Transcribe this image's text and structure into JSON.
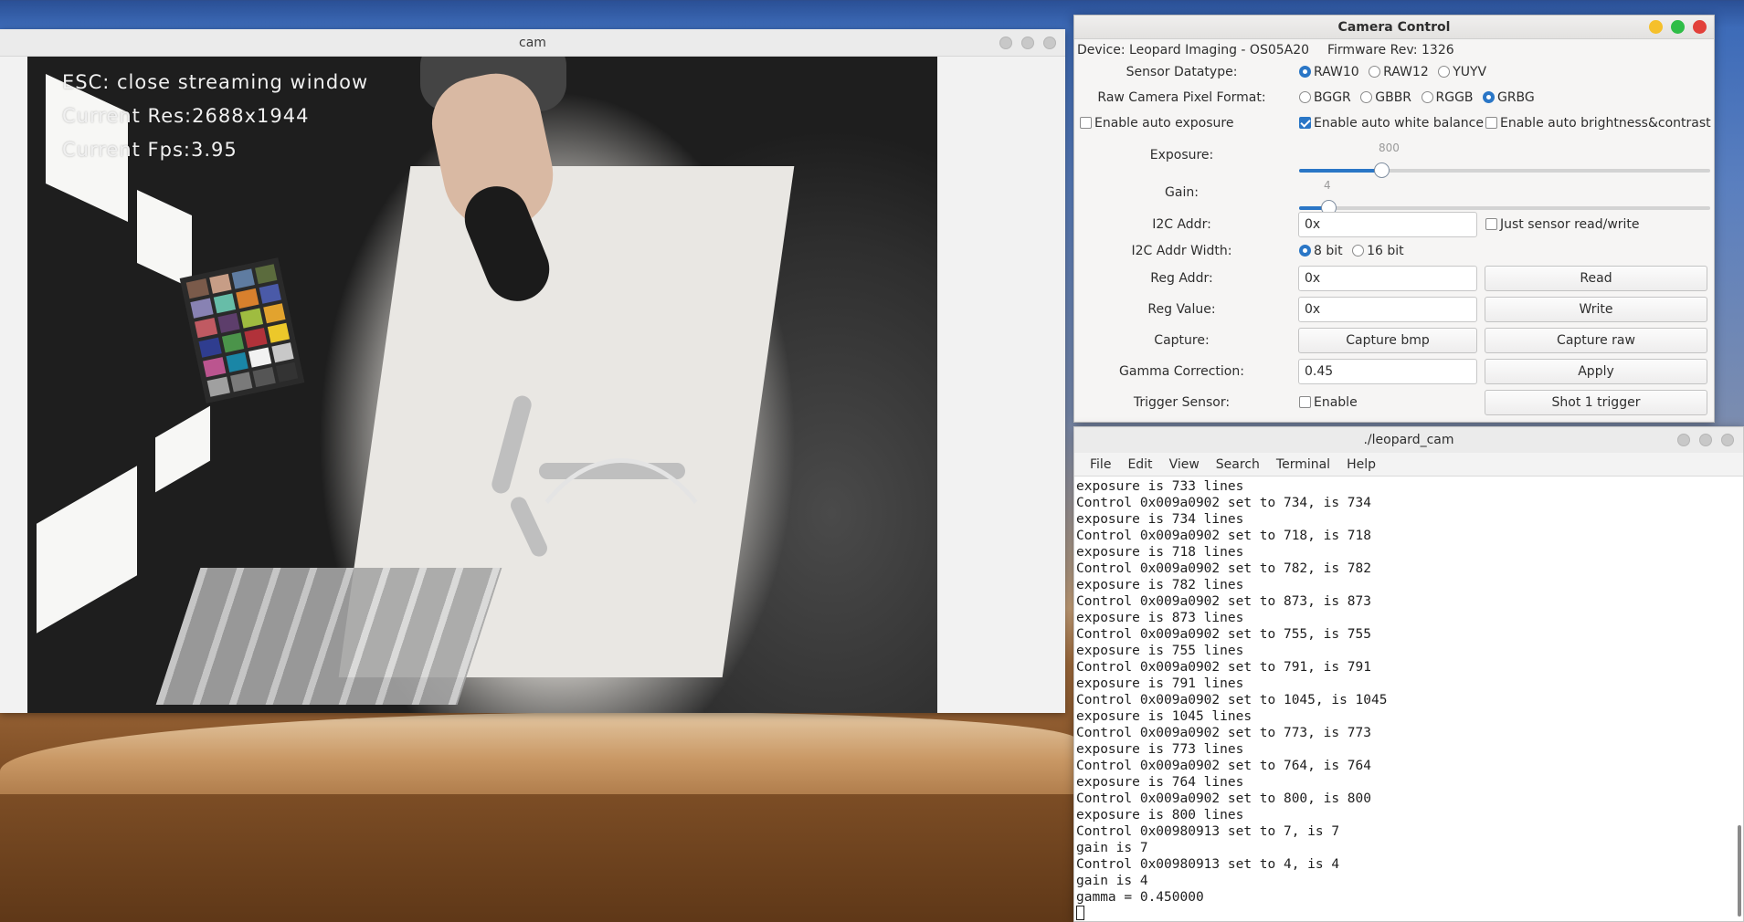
{
  "cam_window": {
    "title": "cam",
    "overlay": {
      "line1": "ESC: close streaming window",
      "line2": "Current Res:2688x1944",
      "line3": "Current Fps:3.95"
    }
  },
  "camera_control": {
    "title": "Camera Control",
    "device": "Device: Leopard Imaging - OS05A20",
    "firmware": "Firmware Rev: 1326",
    "sensor_datatype": {
      "label": "Sensor Datatype:",
      "options": [
        "RAW10",
        "RAW12",
        "YUYV"
      ],
      "selected": "RAW10"
    },
    "pixel_format": {
      "label": "Raw Camera Pixel Format:",
      "options": [
        "BGGR",
        "GBBR",
        "RGGB",
        "GRBG"
      ],
      "selected": "GRBG"
    },
    "auto_exposure": {
      "label": "Enable auto exposure",
      "checked": false
    },
    "auto_white_balance": {
      "label": "Enable auto white balance",
      "checked": true
    },
    "auto_brightness": {
      "label": "Enable auto brightness&contrast",
      "checked": false
    },
    "exposure": {
      "label": "Exposure:",
      "value": "800",
      "fraction": 0.2
    },
    "gain": {
      "label": "Gain:",
      "value": "4",
      "fraction": 0.07
    },
    "i2c_addr": {
      "label": "I2C Addr:",
      "value": "0x"
    },
    "just_sensor": {
      "label": "Just sensor read/write",
      "checked": false
    },
    "i2c_width": {
      "label": "I2C Addr Width:",
      "options": [
        "8 bit",
        "16 bit"
      ],
      "selected": "8 bit"
    },
    "reg_addr": {
      "label": "Reg Addr:",
      "value": "0x",
      "button": "Read"
    },
    "reg_value": {
      "label": "Reg Value:",
      "value": "0x",
      "button": "Write"
    },
    "capture": {
      "label": "Capture:",
      "bmp_button": "Capture bmp",
      "raw_button": "Capture raw"
    },
    "gamma": {
      "label": "Gamma Correction:",
      "value": "0.45",
      "button": "Apply"
    },
    "trigger": {
      "label": "Trigger Sensor:",
      "enable_label": "Enable",
      "checked": false,
      "button": "Shot 1 trigger"
    },
    "colors": {
      "close": "#e2403a",
      "minimize": "#f5c02b",
      "maximize": "#2fbd47",
      "accent": "#2a76c6"
    }
  },
  "terminal": {
    "title": "./leopard_cam",
    "menu": [
      "File",
      "Edit",
      "View",
      "Search",
      "Terminal",
      "Help"
    ],
    "lines": [
      "exposure is 733 lines",
      "Control 0x009a0902 set to 734, is 734",
      "exposure is 734 lines",
      "Control 0x009a0902 set to 718, is 718",
      "exposure is 718 lines",
      "Control 0x009a0902 set to 782, is 782",
      "exposure is 782 lines",
      "Control 0x009a0902 set to 873, is 873",
      "exposure is 873 lines",
      "Control 0x009a0902 set to 755, is 755",
      "exposure is 755 lines",
      "Control 0x009a0902 set to 791, is 791",
      "exposure is 791 lines",
      "Control 0x009a0902 set to 1045, is 1045",
      "exposure is 1045 lines",
      "Control 0x009a0902 set to 773, is 773",
      "exposure is 773 lines",
      "Control 0x009a0902 set to 764, is 764",
      "exposure is 764 lines",
      "Control 0x009a0902 set to 800, is 800",
      "exposure is 800 lines",
      "Control 0x00980913 set to 7, is 7",
      "gain is 7",
      "Control 0x00980913 set to 4, is 4",
      "gain is 4",
      "gamma = 0.450000"
    ]
  }
}
